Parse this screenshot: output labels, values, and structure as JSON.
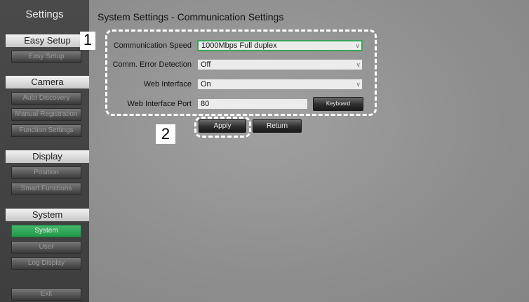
{
  "sidebar": {
    "title": "Settings",
    "sections": [
      {
        "header": "Easy Setup",
        "buttons": [
          "Easy Setup"
        ]
      },
      {
        "header": "Camera",
        "buttons": [
          "Auto Discovery",
          "Manual Registration",
          "Function Settings"
        ]
      },
      {
        "header": "Display",
        "buttons": [
          "Position",
          "Smart Functions"
        ]
      },
      {
        "header": "System",
        "buttons": [
          "System",
          "User",
          "Log Display"
        ]
      }
    ],
    "exit": "Exit",
    "active": "System"
  },
  "main": {
    "title": "System Settings - Communication Settings",
    "fields": [
      {
        "label": "Communication Speed",
        "value": "1000Mbps Full duplex"
      },
      {
        "label": "Comm. Error Detection",
        "value": "Off"
      },
      {
        "label": "Web Interface",
        "value": "On"
      },
      {
        "label": "Web Interface Port",
        "value": "80"
      }
    ],
    "keyboard_label": "Keyboard",
    "apply_label": "Apply",
    "return_label": "Return"
  },
  "callouts": {
    "one": "1",
    "two": "2"
  },
  "icons": {
    "dropdown": "chevron-down-icon"
  },
  "colors": {
    "active": "#2fa856",
    "focus": "#3aa35a"
  }
}
